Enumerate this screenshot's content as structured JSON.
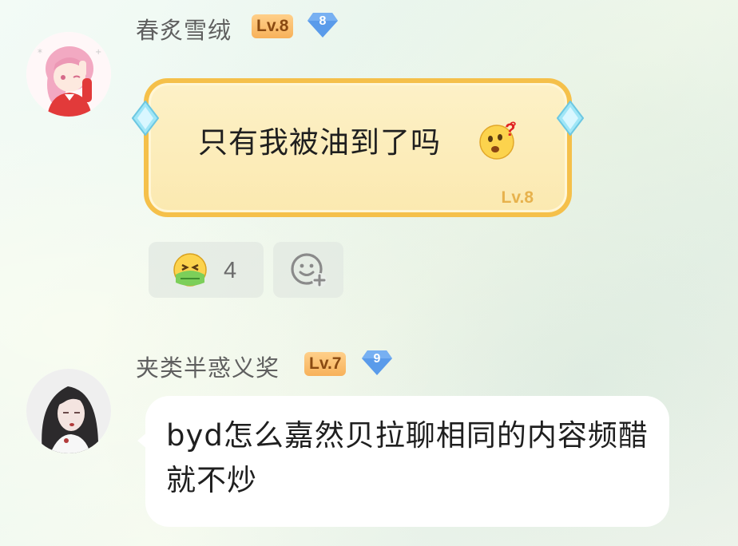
{
  "comments": [
    {
      "username": "春炙雪绒",
      "level_badge": "Lv.8",
      "diamond_level": "8",
      "text": "只有我被油到了吗",
      "bubble_level": "Lv.8",
      "text_emoji": "thinking-face-with-question-marks",
      "reaction": {
        "emoji": "nauseated-face",
        "count": "4"
      },
      "add_reaction_icon": "smiley-plus-icon"
    },
    {
      "username": "夹类半惑义奖",
      "level_badge": "Lv.7",
      "diamond_level": "9",
      "text": "byd怎么嘉然贝拉聊相同的内容频醋就不炒"
    }
  ],
  "colors": {
    "level_badge": "#f7b15a",
    "diamond": "#5a9bea",
    "gold_bubble_border": "#f5c04a",
    "gold_bubble_fill": "#fbe9b0"
  }
}
